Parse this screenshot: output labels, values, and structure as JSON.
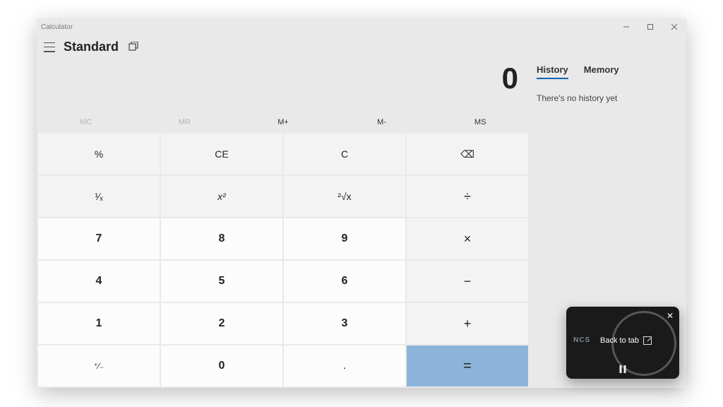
{
  "window": {
    "title": "Calculator"
  },
  "header": {
    "mode": "Standard"
  },
  "display": {
    "value": "0"
  },
  "memory": {
    "mc": "MC",
    "mr": "MR",
    "mplus": "M+",
    "mminus": "M-",
    "ms": "MS"
  },
  "keys": {
    "percent": "%",
    "ce": "CE",
    "c": "C",
    "backspace": "⌫",
    "reciprocal": "¹⁄ₓ",
    "square": "x²",
    "sqrt": "²√x",
    "divide": "÷",
    "n7": "7",
    "n8": "8",
    "n9": "9",
    "multiply": "×",
    "n4": "4",
    "n5": "5",
    "n6": "6",
    "minus": "−",
    "n1": "1",
    "n2": "2",
    "n3": "3",
    "plus": "+",
    "negate": "⁺⁄₋",
    "n0": "0",
    "decimal": ".",
    "equals": "="
  },
  "tabs": {
    "history": "History",
    "memory": "Memory"
  },
  "history": {
    "empty_text": "There's no history yet"
  },
  "pip": {
    "brand": "NCS",
    "back_label": "Back to tab"
  }
}
